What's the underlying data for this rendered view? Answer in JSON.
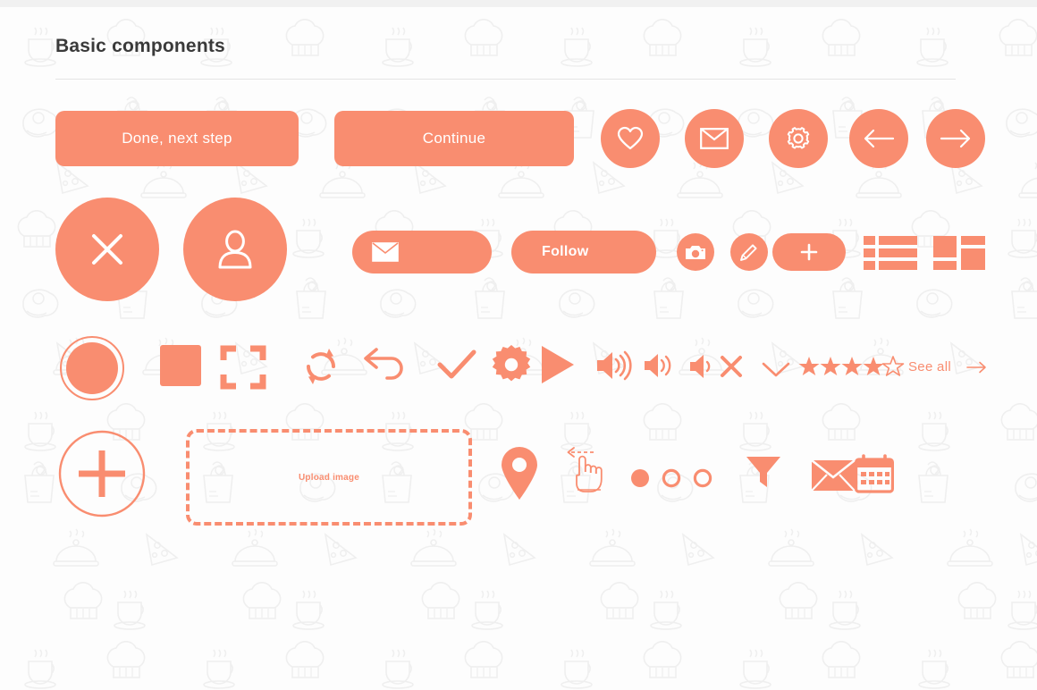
{
  "page": {
    "title": "Basic components",
    "accent_color": "#f98d70",
    "background_color": "#fdfdfd",
    "title_color": "#3a3a3a",
    "watermark_color": "#f0f0f0",
    "watermark_icons": [
      "coffee-cup",
      "chef-hat",
      "cloche",
      "pizza-slice",
      "grocery-bag",
      "steak"
    ]
  },
  "row_primary_buttons": {
    "done_next_step": "Done, next step",
    "continue": "Continue",
    "circle_icons": [
      "heart-icon",
      "envelope-icon",
      "gear-icon",
      "arrow-left-icon",
      "arrow-right-icon"
    ]
  },
  "row_actions": {
    "close_icon": "close-icon",
    "user_icon": "user-icon",
    "mail_pill_icon": "envelope-icon",
    "follow_label": "Follow",
    "camera_icon": "camera-icon",
    "edit_icon": "pencil-icon",
    "add_pill_icon": "plus-icon",
    "list_view_icon": "list-view-icon",
    "grid_view_icon": "grid-view-icon"
  },
  "row_media_controls": {
    "record_icon": "record-icon",
    "stop_icon": "stop-icon",
    "fullscreen_icon": "fullscreen-icon",
    "refresh_icon": "refresh-icon",
    "undo_icon": "undo-icon",
    "check_icon": "check-icon",
    "settings_icon": "gear-filled-icon",
    "play_icon": "play-icon",
    "volume_high_icon": "volume-high-icon",
    "volume_low_icon": "volume-low-icon",
    "volume_mute_icon": "volume-mute-icon",
    "chevron_down_icon": "chevron-down-icon",
    "rating_filled": 4,
    "rating_total": 5,
    "see_all_label": "See all",
    "see_all_arrow_icon": "arrow-right-icon"
  },
  "row_inputs": {
    "add_button_icon": "plus-circle-icon",
    "upload_label": "Upload image",
    "location_icon": "map-pin-icon",
    "swipe_icon": "swipe-left-hand-icon",
    "pagination_dots": [
      "filled",
      "hollow",
      "hollow"
    ],
    "filter_icon": "filter-funnel-icon",
    "mail_icon": "envelope-filled-icon",
    "calendar_icon": "calendar-icon"
  }
}
